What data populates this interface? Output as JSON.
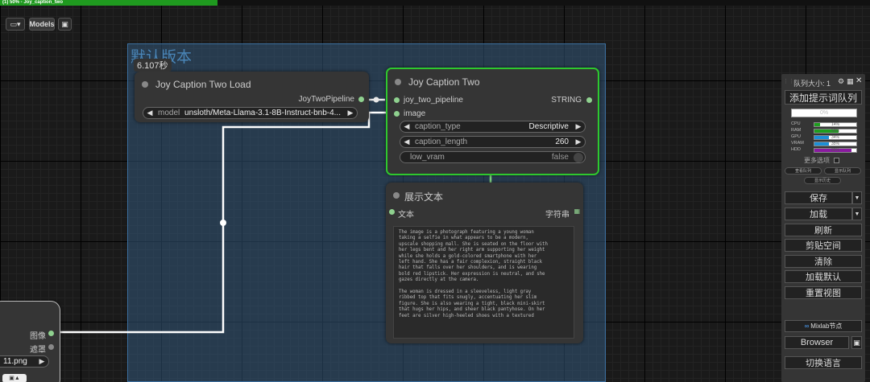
{
  "progress": {
    "label": "(1) 50% - Joy_caption_two",
    "fraction": 0.5,
    "color": "#1f9a1f"
  },
  "toolbar": {
    "folder_icon": "▭▾",
    "models_label": "Models",
    "save_icon": "▣"
  },
  "group": {
    "title": "默认版本",
    "time": "6.107秒"
  },
  "node_load": {
    "title": "Joy Caption Two Load",
    "output_label": "JoyTwoPipeline",
    "widget_label": "model",
    "widget_value": "unsloth/Meta-Llama-3.1-8B-Instruct-bnb-4..."
  },
  "node_jct": {
    "title": "Joy Caption Two",
    "input_pipeline": "joy_two_pipeline",
    "input_image": "image",
    "output_label": "STRING",
    "caption_type_label": "caption_type",
    "caption_type_value": "Descriptive",
    "caption_length_label": "caption_length",
    "caption_length_value": "260",
    "low_vram_label": "low_vram",
    "low_vram_value": "false"
  },
  "node_show": {
    "title": "展示文本",
    "input_label": "文本",
    "output_label": "字符串",
    "text": "The image is a photograph featuring a young woman\ntaking a selfie in what appears to be a modern,\nupscale shopping mall. She is seated on the floor with\nher legs bent and her right arm supporting her weight\nwhile she holds a gold-colored smartphone with her\nleft hand. She has a fair complexion, straight black\nhair that falls over her shoulders, and is wearing\nbold red lipstick. Her expression is neutral, and she\ngazes directly at the camera.\n\nThe woman is dressed in a sleeveless, light gray\nribbed top that fits snugly, accentuating her slim\nfigure. She is also wearing a tight, black mini-skirt\nthat hugs her hips, and sheer black pantyhose. On her\nfeet are silver high-heeled shoes with a textured"
  },
  "node_left": {
    "output_image": "图像",
    "output_mask": "遮罩",
    "file_value": "11.png"
  },
  "queue": {
    "title": "队列大小: 1",
    "add_prompt": "添加提示词队列",
    "progress_text": "0%",
    "meters": [
      {
        "label": "CPU",
        "value": "14%",
        "fraction": 0.14,
        "color": "#1e9e1e"
      },
      {
        "label": "RAM",
        "value": "58%",
        "fraction": 0.58,
        "color": "#1e9e1e"
      },
      {
        "label": "GPU",
        "value": "34%",
        "fraction": 0.34,
        "color": "#1d8fd6"
      },
      {
        "label": "VRAM",
        "value": "35%",
        "fraction": 0.35,
        "color": "#1d8fd6"
      },
      {
        "label": "HDD",
        "value": "89%",
        "fraction": 0.89,
        "color": "#8a1aa0"
      }
    ],
    "more_options": "更多选项",
    "view_queue": "查看队列",
    "show_queue": "显示队列",
    "view_history": "显示历史",
    "save": "保存",
    "load": "加载",
    "refresh": "刷新",
    "clipspace": "剪贴空间",
    "clear": "清除",
    "load_default": "加载默认",
    "reset_view": "重置视图",
    "mixlab": "Mixlab节点",
    "browser": "Browser",
    "switch_language": "切换语言"
  }
}
